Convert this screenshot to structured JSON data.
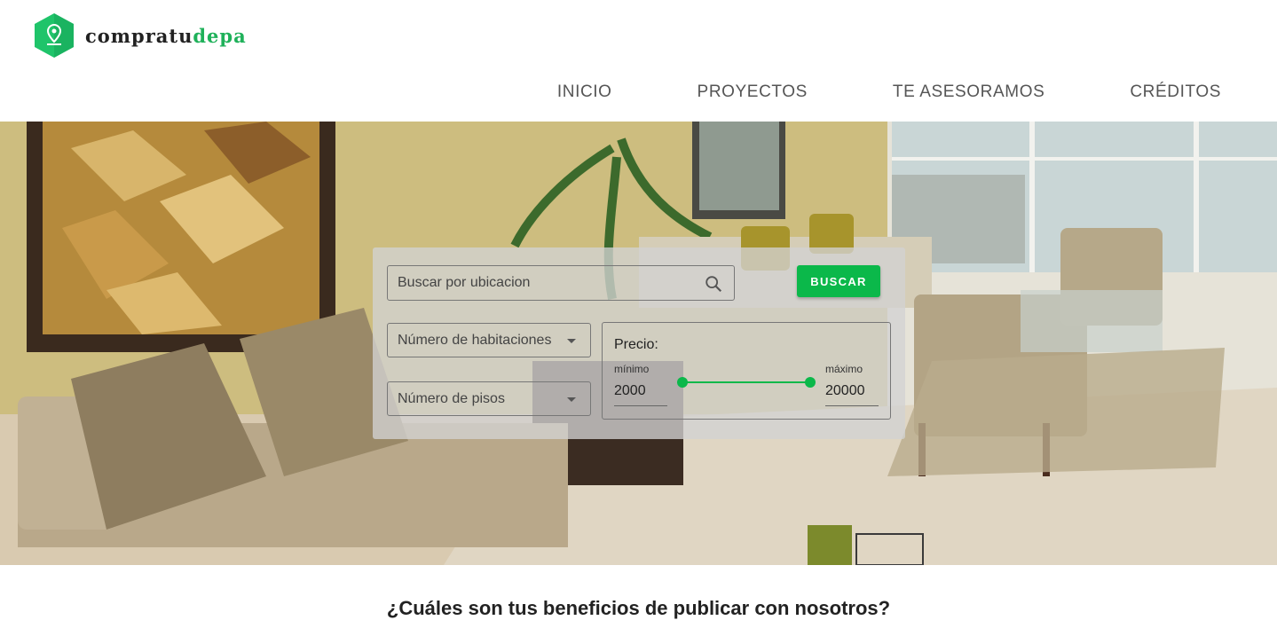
{
  "brand": {
    "name_part1": "compratu",
    "name_part2": "depa",
    "icon": "location-pin-icon",
    "brand_color": "#1fb15a"
  },
  "nav": {
    "items": [
      "INICIO",
      "PROYECTOS",
      "TE ASESORAMOS",
      "CRÉDITOS"
    ]
  },
  "search": {
    "location_placeholder": "Buscar por ubicacion",
    "search_icon": "search-icon",
    "button_label": "BUSCAR",
    "rooms_placeholder": "Número de habitaciones",
    "floors_placeholder": "Número de pisos",
    "price": {
      "title": "Precio:",
      "min_label": "mínimo",
      "max_label": "máximo",
      "min_value": "2000",
      "max_value": "20000"
    },
    "accent_color": "#0bb84a"
  },
  "section": {
    "title": "¿Cuáles son tus beneficios de publicar con nosotros?"
  }
}
